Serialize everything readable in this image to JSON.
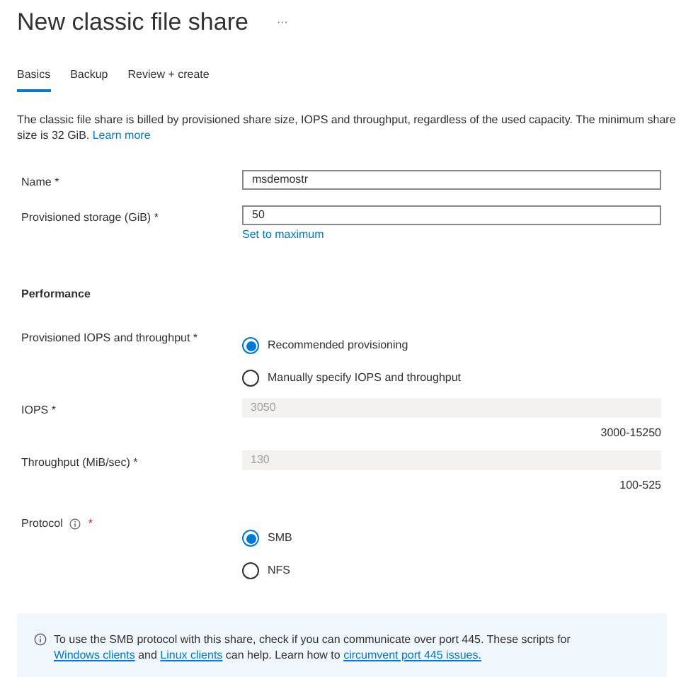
{
  "title": "New classic file share",
  "more": "···",
  "tabs": [
    {
      "label": "Basics",
      "selected": true
    },
    {
      "label": "Backup",
      "selected": false
    },
    {
      "label": "Review + create",
      "selected": false
    }
  ],
  "description": [
    {
      "kind": "text",
      "text": "The classic file share is billed by provisioned share size, IOPS and throughput, regardless of the used capacity. The minimum share size is 32 GiB. "
    },
    {
      "kind": "link",
      "text": "Learn more"
    }
  ],
  "fields": [
    {
      "label": "Name *",
      "value": "msdemostr",
      "disabled": false
    },
    {
      "label": "Provisioned storage (GiB) *",
      "value": "50",
      "disabled": false,
      "link": "Set to maximum"
    }
  ],
  "performance": {
    "heading": "Performance",
    "provisioning": {
      "label": "Provisioned IOPS and throughput *",
      "options": [
        {
          "label": "Recommended provisioning",
          "selected": true
        },
        {
          "label": "Manually specify IOPS and throughput",
          "selected": false
        }
      ]
    },
    "fields": [
      {
        "label": "IOPS *",
        "value": "3050",
        "disabled": true,
        "range": "3000-15250"
      },
      {
        "label": "Throughput (MiB/sec) *",
        "value": "130",
        "disabled": true,
        "range": "100-525"
      }
    ]
  },
  "protocol": {
    "label": "Protocol",
    "required": "*",
    "options": [
      {
        "label": "SMB",
        "selected": true
      },
      {
        "label": "NFS",
        "selected": false
      }
    ]
  },
  "notice": [
    {
      "kind": "text",
      "text": "To use the SMB protocol with this share, check if you can communicate over port 445. These scripts for "
    },
    {
      "kind": "link",
      "text": "Windows clients"
    },
    {
      "kind": "text",
      "text": " and "
    },
    {
      "kind": "link",
      "text": "Linux clients"
    },
    {
      "kind": "text",
      "text": " can help. Learn how to "
    },
    {
      "kind": "link",
      "text": "circumvent port 445 issues."
    }
  ]
}
